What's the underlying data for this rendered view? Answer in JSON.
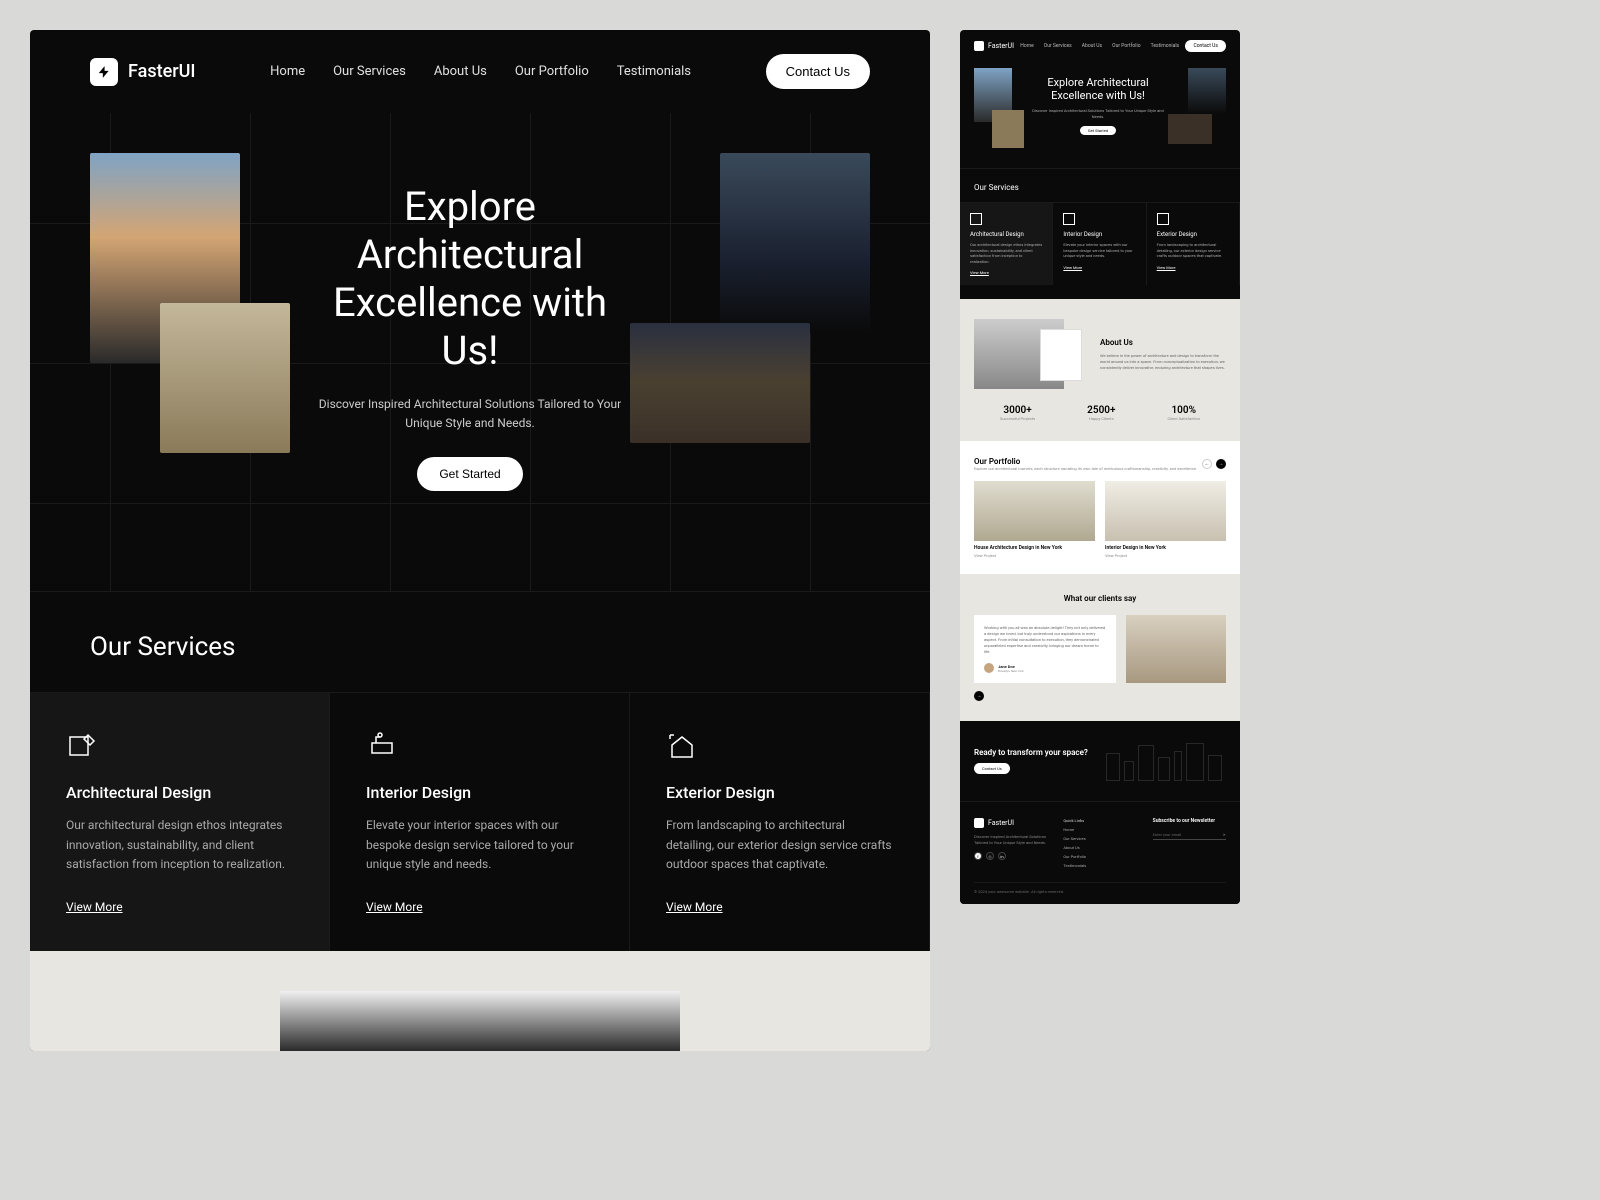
{
  "brand": "FasterUI",
  "nav": {
    "links": [
      "Home",
      "Our Services",
      "About Us",
      "Our Portfolio",
      "Testimonials"
    ],
    "contact": "Contact Us"
  },
  "hero": {
    "title": "Explore Architectural Excellence with Us!",
    "sub": "Discover Inspired Architectural Solutions Tailored to Your Unique Style and Needs.",
    "cta": "Get Started"
  },
  "services": {
    "heading": "Our Services",
    "items": [
      {
        "title": "Architectural Design",
        "desc": "Our architectural design ethos integrates innovation, sustainability, and client satisfaction from inception to realization.",
        "link": "View More"
      },
      {
        "title": "Interior Design",
        "desc": "Elevate your interior spaces with our bespoke design service tailored to your unique style and needs.",
        "link": "View More"
      },
      {
        "title": "Exterior Design",
        "desc": "From landscaping to architectural detailing, our exterior design service crafts outdoor spaces that captivate.",
        "link": "View More"
      }
    ]
  },
  "about": {
    "heading": "About Us",
    "body": "We believe in the power of architecture and design to transform the world around us into a space. From conceptualization to execution, we consistently deliver innovative, enduring architecture that shapes lives.",
    "stats": [
      {
        "n": "3000+",
        "l": "Successful Projects"
      },
      {
        "n": "2500+",
        "l": "Happy Clients"
      },
      {
        "n": "100%",
        "l": "Client Satisfaction"
      }
    ]
  },
  "portfolio": {
    "heading": "Our Portfolio",
    "sub": "Explore our architectural marvels, each structure narrating its own tale of meticulous craftsmanship, creativity, and excellence.",
    "items": [
      {
        "title": "House Architecture Design in New York",
        "link": "View Project"
      },
      {
        "title": "Interior Design in New York",
        "link": "View Project"
      }
    ]
  },
  "testimonials": {
    "heading": "What our clients say",
    "body": "Working with you all was an absolute delight! They not only delivered a design we loved, but truly understood our aspirations in every aspect. From initial consultation to execution, they demonstrated unparalleled expertise and creativity, bringing our dream home to life.",
    "author": {
      "name": "Jane Doe",
      "loc": "Brooklyn, New York"
    }
  },
  "cta2": {
    "heading": "Ready to transform your space?",
    "button": "Contact Us"
  },
  "footer": {
    "tag": "Discover Inspired Architectural Solutions Tailored to Your Unique Style and Needs.",
    "quick_heading": "Quick Links",
    "quick": [
      "Home",
      "Our Services",
      "About Us",
      "Our Portfolio",
      "Testimonials"
    ],
    "news_heading": "Subscribe to our Newsletter",
    "news_placeholder": "Enter your email",
    "copy": "© 2024 your awesome website. All rights reserved."
  }
}
